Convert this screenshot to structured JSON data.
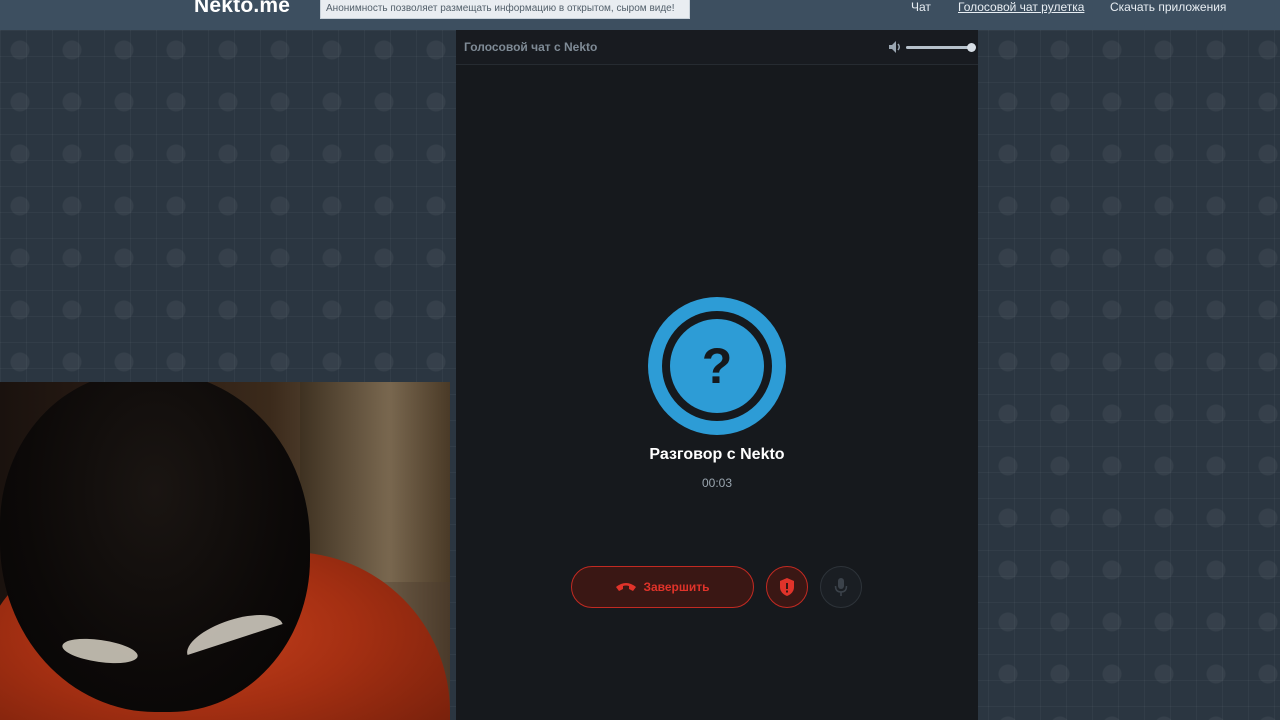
{
  "header": {
    "logo": "Nekto.me",
    "notice": "Анонимность позволяет размещать информацию в открытом, сыром виде!",
    "nav": {
      "chat": "Чат",
      "voice_roulette": "Голосовой чат рулетка",
      "download_apps": "Скачать приложения"
    }
  },
  "call_panel": {
    "title": "Голосовой чат с Nekto",
    "volume_level": 1.0,
    "avatar_symbol": "?",
    "call_title": "Разговор с Nekto",
    "timer": "00:03",
    "end_button_label": "Завершить",
    "icons": {
      "volume": "speaker-icon",
      "end_call": "phone-hangup-icon",
      "report": "shield-icon",
      "mic": "microphone-icon"
    },
    "colors": {
      "accent": "#2d9cd6",
      "danger": "#e0332a"
    }
  }
}
